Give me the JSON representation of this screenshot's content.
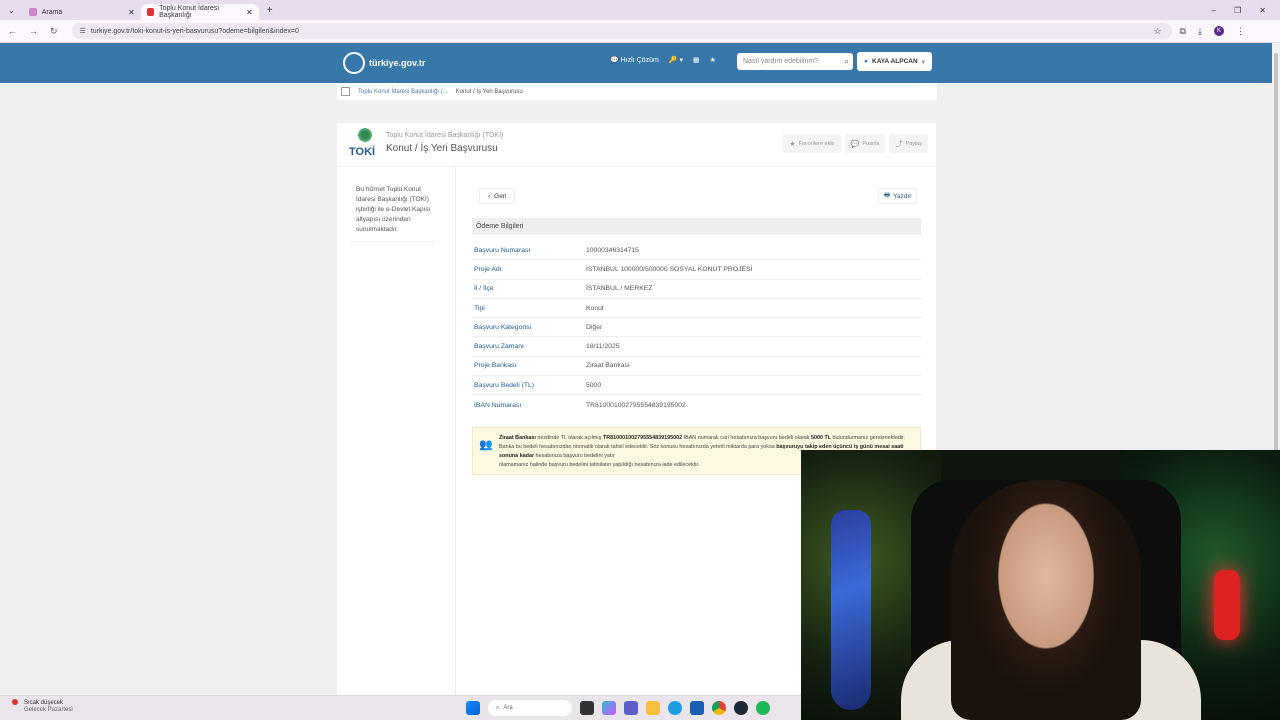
{
  "browser": {
    "tabs": [
      {
        "label": "Arama"
      },
      {
        "label": "Toplu Konut İdaresi Başkanlığı"
      }
    ],
    "url": "turkiye.gov.tr/toki-konut-is-yeri-basvurusu?odeme=bilgileri&index=0",
    "profile_initial": "K"
  },
  "header": {
    "logo": "türkiye.gov.tr",
    "quick_solution": "Hızlı Çözüm",
    "search_placeholder": "Nasıl yardım edebilirim?",
    "user": "KAYA ALPCAN"
  },
  "breadcrumb": {
    "parent": "Toplu Konut İdaresi Başkanlığı (...",
    "current": "Konut / İş Yeri Başvurusu"
  },
  "service": {
    "logo_text": "TOKİ",
    "institution": "Toplu Konut İdaresi Başkanlığı (TOKİ)",
    "title": "Konut / İş Yeri Başvurusu",
    "actions": {
      "favorite": "Favorilere ekle",
      "rate": "Puanla",
      "share": "Paylaş"
    },
    "side_note": "Bu hizmet Toplu Konut İdaresi Başkanlığı (TOKİ) işbirliği ile e-Devlet Kapısı altyapısı üzerinden sunulmaktadır."
  },
  "panel": {
    "back": "Geri",
    "print": "Yazdır",
    "section_title": "Ödeme Bilgileri",
    "rows": [
      {
        "label": "Başvuru Numarası",
        "value": "10000346314715"
      },
      {
        "label": "Proje Adı",
        "value": "İSTANBUL 100000/500000 SOSYAL KONUT PROJESİ"
      },
      {
        "label": "İl / İlçe",
        "value": "İSTANBUL / MERKEZ"
      },
      {
        "label": "Tipi",
        "value": "Konut"
      },
      {
        "label": "Başvuru Kategorisi",
        "value": "Diğer"
      },
      {
        "label": "Başvuru Zamanı",
        "value": "18/11/2025"
      },
      {
        "label": "Proje Bankası",
        "value": "Ziraat Bankası"
      },
      {
        "label": "Başvuru Bedeli (TL)",
        "value": "5000"
      },
      {
        "label": "IBAN Numarası",
        "value": "TR810001002795554839195002"
      }
    ],
    "info": {
      "bank": "Ziraat Bankası",
      "part1": " nezdinde TL olarak açılmış ",
      "iban": "TR810001002795554839195002",
      "part2": " IBAN numaralı cari hesabınıza başvuru bedeli olarak ",
      "amount": "5000 TL",
      "part3": " bulundurmanız gerekmektedir. Banka bu bedeli hesabınızdan otomatik olarak tahsil edecektir. Söz konusu hesabınızda yeterli miktarda para yoksa ",
      "deadline": "başvuruyu takip eden üçüncü iş günü mesai saati sonuna kadar",
      "part4": " hesabınıza başvuru bedelini yatır",
      "part5": "olamamanız halinde başvuru bedelini tahsilatın yapıldığı hesabınıza iade edilecektir."
    }
  },
  "taskbar": {
    "weather_title": "Sıcak düşecek",
    "weather_sub": "Gelecek Pazartesi",
    "weather_badge": "1",
    "search": "Ara"
  }
}
